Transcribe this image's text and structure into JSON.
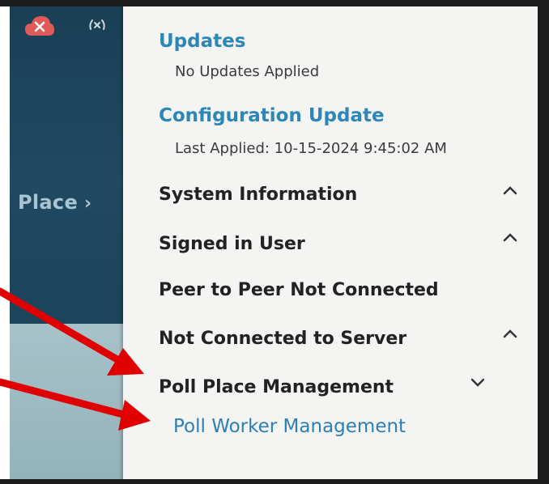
{
  "left_panel": {
    "nav_label": "Place",
    "nav_chevron": "›",
    "icons": [
      "cloud-x-icon",
      "signal-x-icon"
    ]
  },
  "menu": {
    "updates": {
      "title": "Updates",
      "status": "No Updates Applied"
    },
    "configuration": {
      "title": "Configuration Update",
      "status": "Last Applied: 10-15-2024 9:45:02 AM"
    },
    "items": [
      {
        "label": "System Information",
        "caret": "up"
      },
      {
        "label": "Signed in User",
        "caret": "up"
      },
      {
        "label": "Peer to Peer Not Connected",
        "caret": "none"
      },
      {
        "label": "Not Connected to Server",
        "caret": "up"
      },
      {
        "label": "Poll Place Management",
        "caret": "down"
      }
    ],
    "sub_items": [
      {
        "label": "Poll Worker Management"
      }
    ]
  },
  "colors": {
    "heading": "#2c86b8",
    "annotation_arrow": "#e00000",
    "cloud_icon": "#e05a5a"
  }
}
